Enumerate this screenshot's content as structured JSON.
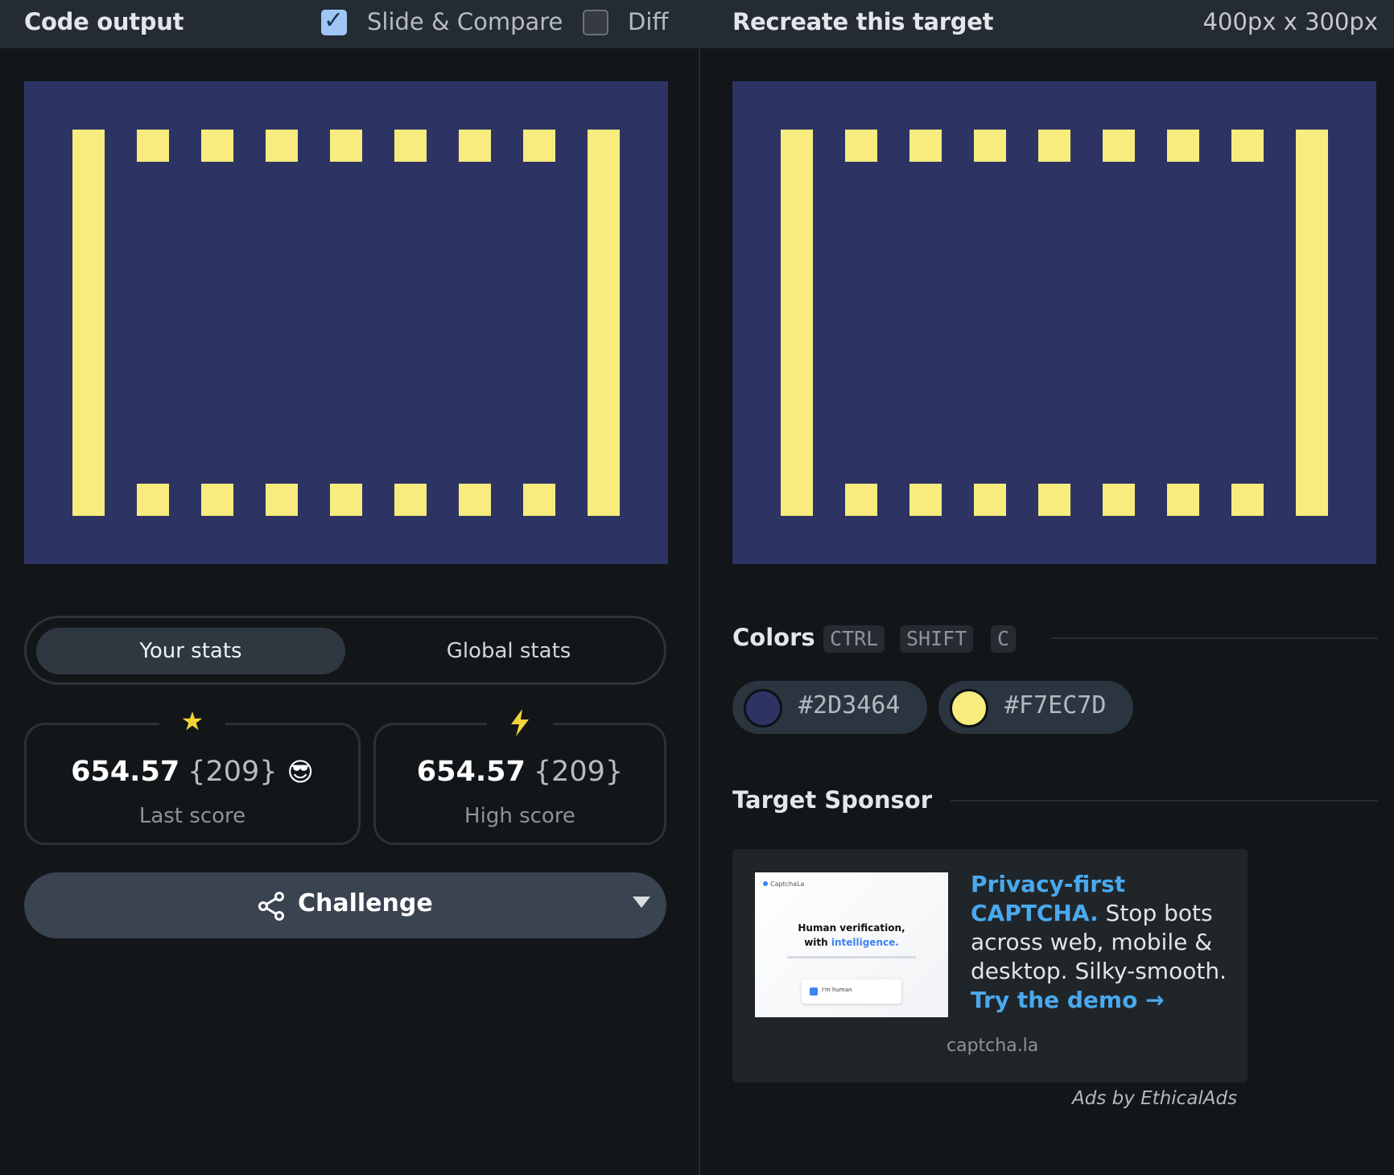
{
  "left": {
    "title": "Code output",
    "slide_compare": {
      "label": "Slide & Compare",
      "checked": true
    },
    "diff": {
      "label": "Diff",
      "checked": false
    },
    "tabs": {
      "your_stats": "Your stats",
      "global_stats": "Global stats"
    },
    "last_score": {
      "value": "654.57",
      "count": "{209}",
      "emoji": "😎",
      "label": "Last score",
      "icon": "star-icon"
    },
    "high_score": {
      "value": "654.57",
      "count": "{209}",
      "label": "High score",
      "icon": "lightning-icon"
    },
    "challenge": {
      "label": "Challenge",
      "icon": "share-icon"
    }
  },
  "right": {
    "title": "Recreate this target",
    "dimensions": "400px x 300px",
    "colors": {
      "heading": "Colors",
      "shortcut": [
        "CTRL",
        "SHIFT",
        "C"
      ],
      "swatches": [
        {
          "hex": "#2D3464",
          "color": "#2d3464"
        },
        {
          "hex": "#F7EC7D",
          "color": "#f7ec7d"
        }
      ]
    },
    "sponsor": {
      "heading": "Target Sponsor",
      "image": {
        "brand": "CaptchaLa",
        "headline_1": "Human verification,",
        "headline_2a": "with ",
        "headline_2b": "intelligence.",
        "checkbox_label": "I'm human"
      },
      "strong": "Privacy-first CAPTCHA.",
      "body": " Stop bots across web, mobile & desktop. Silky-smooth. ",
      "cta": "Try the demo →",
      "host": "captcha.la",
      "ads_by": "Ads by EthicalAds"
    }
  },
  "palette": {
    "background": "#2d3464",
    "foreground": "#f7ec7d",
    "accent_blue": "#4aa9ee"
  }
}
